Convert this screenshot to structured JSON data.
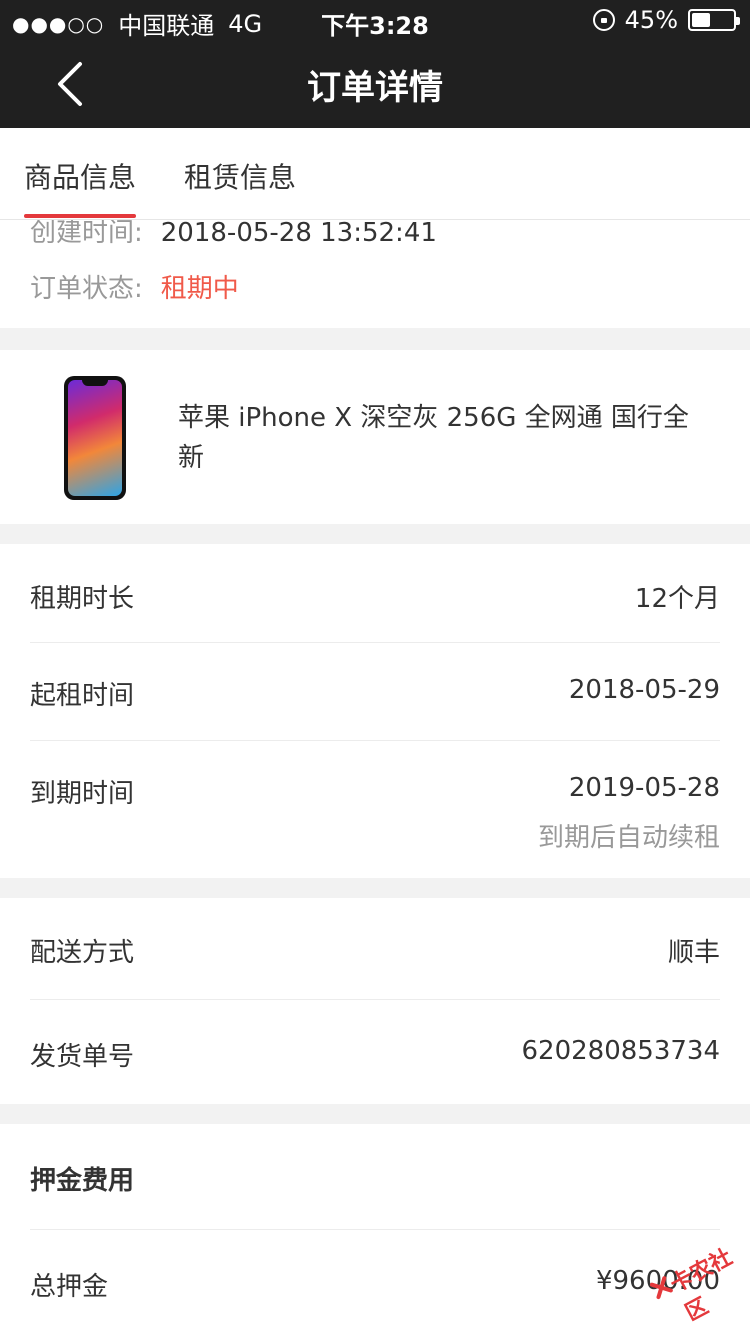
{
  "status_bar": {
    "carrier": "中国联通",
    "network": "4G",
    "time": "下午3:28",
    "battery_text": "45%",
    "battery_level": 0.45
  },
  "nav": {
    "title": "订单详情"
  },
  "tabs": [
    {
      "label": "商品信息",
      "active": true
    },
    {
      "label": "租赁信息",
      "active": false
    }
  ],
  "order": {
    "created_label": "创建时间:",
    "created_value": "2018-05-28 13:52:41",
    "status_label": "订单状态:",
    "status_value": "租期中"
  },
  "product": {
    "name": "苹果 iPhone X 深空灰 256G 全网通 国行全新"
  },
  "lease": {
    "duration_label": "租期时长",
    "duration_value": "12个月",
    "start_label": "起租时间",
    "start_value": "2018-05-29",
    "end_label": "到期时间",
    "end_value": "2019-05-28",
    "end_note": "到期后自动续租"
  },
  "delivery": {
    "method_label": "配送方式",
    "method_value": "顺丰",
    "tracking_label": "发货单号",
    "tracking_value": "620280853734"
  },
  "deposit": {
    "section_title": "押金费用",
    "total_label": "总押金",
    "total_value": "¥9600.00"
  },
  "watermark": {
    "text": "卡农社区"
  },
  "colors": {
    "topbar": "#202020",
    "accent": "#e4393c",
    "status_text": "#f05a4a",
    "background": "#f2f2f2"
  }
}
